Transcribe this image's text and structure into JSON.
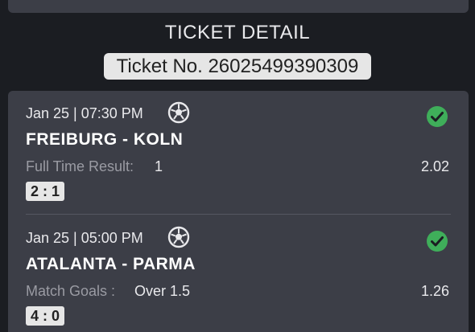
{
  "header": {
    "title": "TICKET DETAIL",
    "ticket_no": "Ticket No. 26025499390309"
  },
  "bets": [
    {
      "time": "Jan 25 | 07:30 PM",
      "teams": "FREIBURG - KOLN",
      "market": "Full Time Result:",
      "pick": "1",
      "odds": "2.02",
      "score": "2 : 1",
      "status": "won",
      "sport_icon": "soccer-ball-icon"
    },
    {
      "time": "Jan 25 | 05:00 PM",
      "teams": "ATALANTA - PARMA",
      "market": "Match Goals :",
      "pick": "Over 1.5",
      "odds": "1.26",
      "score": "4 : 0",
      "status": "won",
      "sport_icon": "soccer-ball-icon"
    }
  ],
  "colors": {
    "background": "#1b1d22",
    "panel": "#3c3e47",
    "won_green": "#3fae5a"
  }
}
